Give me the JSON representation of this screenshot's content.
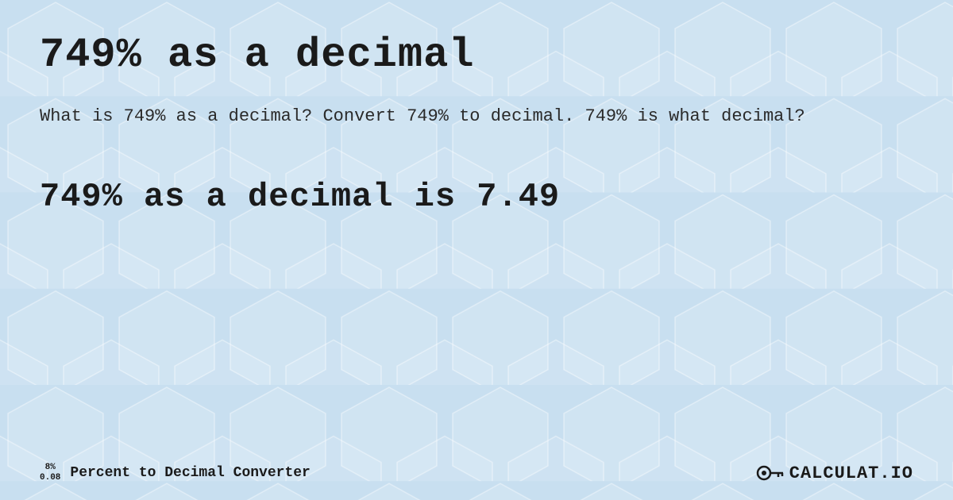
{
  "page": {
    "title": "749% as a decimal",
    "description": "What is 749% as a decimal? Convert 749% to decimal. 749% is what decimal?",
    "result": "749% as a decimal is 7.49",
    "background_color": "#c8dff0"
  },
  "footer": {
    "percent_top": "8%",
    "percent_bottom": "0.08",
    "label": "Percent to Decimal Converter",
    "logo_text": "CALCULAT.IO"
  }
}
